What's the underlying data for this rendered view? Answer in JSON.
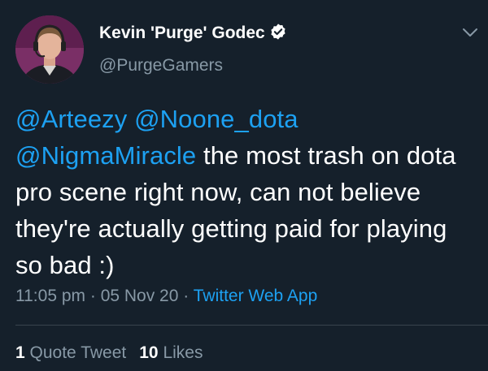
{
  "author": {
    "display_name": "Kevin 'Purge' Godec",
    "handle": "@PurgeGamers",
    "verified": true
  },
  "tweet": {
    "mention_1": "@Arteezy",
    "mention_2": "@Noone_dota",
    "mention_3": "@NigmaMiracle",
    "text": "the most trash on dota pro scene right now, can not believe they're actually getting paid for playing so bad :)"
  },
  "meta": {
    "time": "11:05 pm",
    "separator": "·",
    "date": "05 Nov 20",
    "source": "Twitter Web App"
  },
  "stats": {
    "quote_count": "1",
    "quote_label": "Quote Tweet",
    "like_count": "10",
    "like_label": "Likes"
  },
  "colors": {
    "background": "#15202b",
    "link": "#1da1f2",
    "secondary_text": "#8899a6"
  },
  "icons": [
    "verified-badge-icon",
    "chevron-down-icon"
  ]
}
